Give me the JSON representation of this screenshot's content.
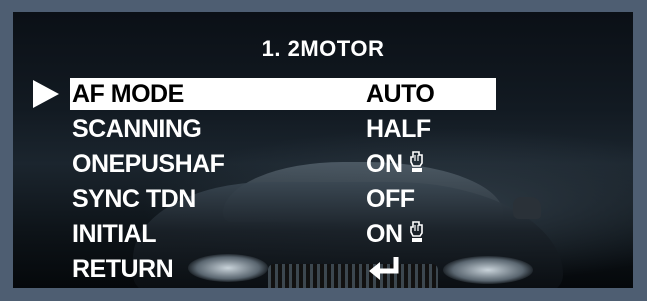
{
  "menu": {
    "title": "1. 2MOTOR",
    "items": [
      {
        "label": "AF MODE",
        "value": "AUTO",
        "selected": true
      },
      {
        "label": "SCANNING",
        "value": "HALF",
        "selected": false
      },
      {
        "label": "ONEPUSHAF",
        "value": "ON",
        "selected": false,
        "icon": "hand-icon"
      },
      {
        "label": "SYNC TDN",
        "value": "OFF",
        "selected": false
      },
      {
        "label": "INITIAL",
        "value": "ON",
        "selected": false,
        "icon": "hand-icon"
      },
      {
        "label": "RETURN",
        "value": "",
        "selected": false,
        "icon": "enter-icon"
      }
    ]
  },
  "colors": {
    "frame": "#4e5e72",
    "text": "#ffffff",
    "highlight": "#ffffff",
    "highlight_text": "#000000"
  }
}
